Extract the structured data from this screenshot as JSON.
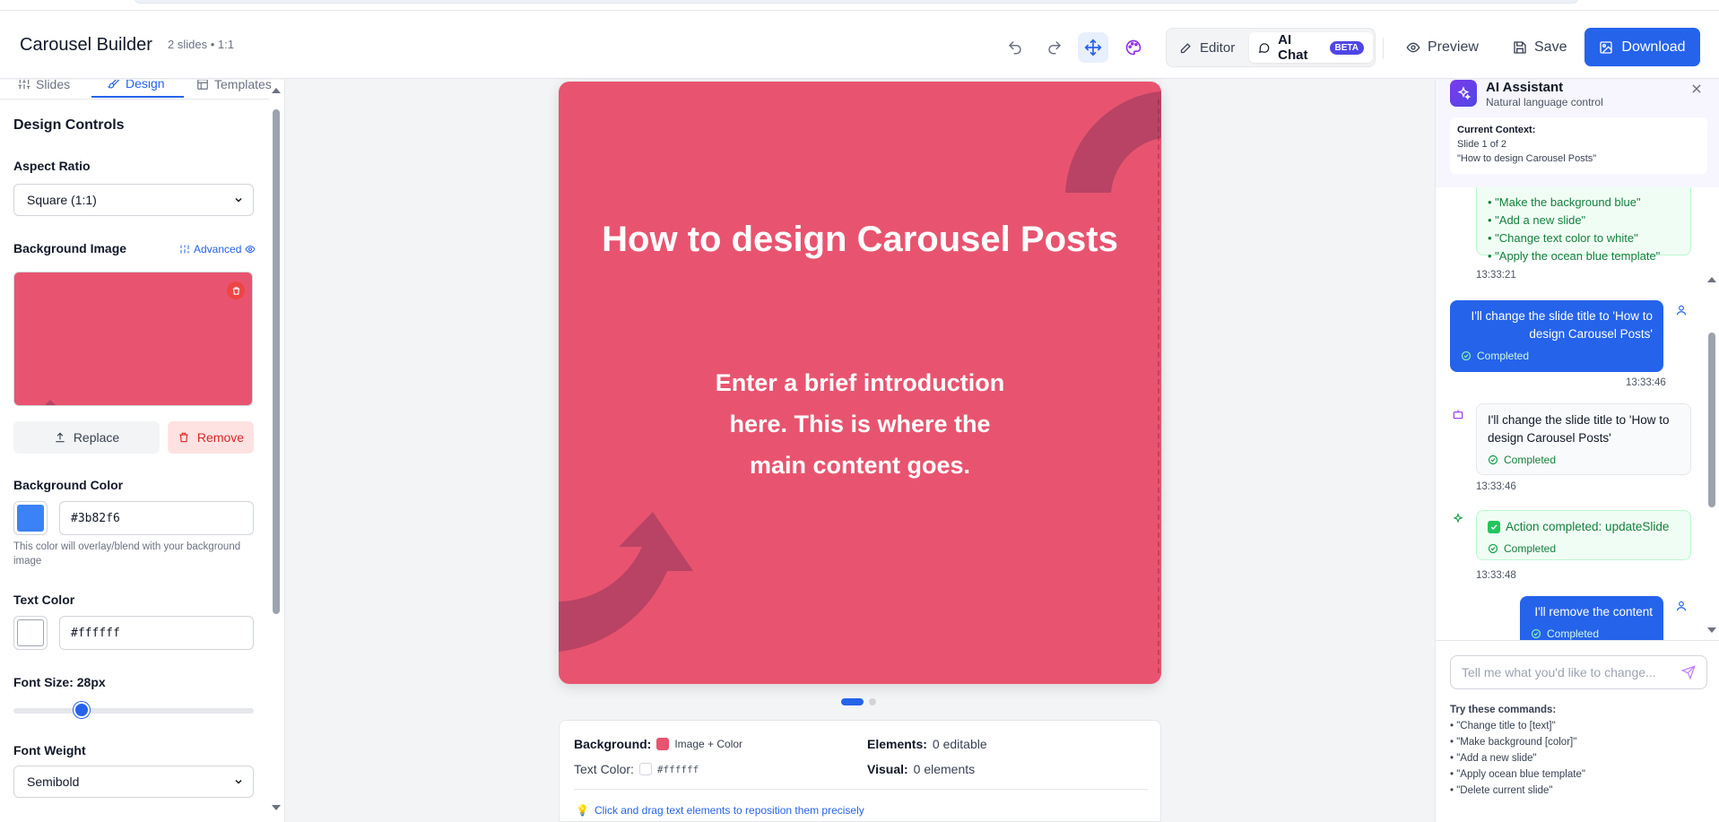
{
  "header": {
    "title": "Carousel Builder",
    "subtitle": "2 slides • 1:1",
    "modes": [
      {
        "label": "Editor"
      },
      {
        "label": "AI Chat",
        "badge": "BETA"
      }
    ],
    "preview_label": "Preview",
    "save_label": "Save",
    "download_label": "Download"
  },
  "sidebar": {
    "tabs": [
      {
        "label": "Slides"
      },
      {
        "label": "Design"
      },
      {
        "label": "Templates"
      }
    ],
    "active_tab": "Design",
    "section_title": "Design Controls",
    "aspect_ratio": {
      "label": "Aspect Ratio",
      "value": "Square (1:1)"
    },
    "background_image": {
      "label": "Background Image",
      "advanced_label": "Advanced",
      "replace_label": "Replace",
      "remove_label": "Remove"
    },
    "background_color": {
      "label": "Background Color",
      "value": "#3b82f6",
      "hint": "This color will overlay/blend with your background image"
    },
    "text_color": {
      "label": "Text Color",
      "value": "#ffffff"
    },
    "font_size": {
      "label": "Font Size: 28px",
      "value_fraction": 0.25
    },
    "font_weight": {
      "label": "Font Weight",
      "value": "Semibold"
    }
  },
  "slide": {
    "title": "How to design Carousel Posts",
    "body": "Enter a brief introduction here. This is where the main content goes.",
    "background": "#e8546f",
    "total": 2,
    "current": 1
  },
  "info": {
    "background_label": "Background:",
    "background_value": "Image + Color",
    "text_color_label": "Text Color:",
    "text_color_value": "#ffffff",
    "elements_label": "Elements:",
    "elements_value": "0 editable",
    "visual_label": "Visual:",
    "visual_value": "0 elements",
    "tip": "Click and drag text elements to reposition them precisely"
  },
  "assistant": {
    "title": "AI Assistant",
    "subtitle": "Natural language control",
    "context_label": "Current Context:",
    "context_slide": "Slide 1 of 2",
    "context_title": "\"How to design Carousel Posts\"",
    "suggestions": [
      "• \"Make the background blue\"",
      "• \"Add a new slide\"",
      "• \"Change text color to white\"",
      "• \"Apply the ocean blue template\""
    ],
    "messages": [
      {
        "time": "13:33:21"
      },
      {
        "role": "user",
        "text": "I'll change the slide title to 'How to design Carousel Posts'",
        "status": "Completed",
        "time": "13:33:46"
      },
      {
        "role": "bot",
        "text": "I'll change the slide title to 'How to design Carousel Posts'",
        "status": "Completed",
        "time": "13:33:46"
      },
      {
        "role": "bot",
        "text": "Action completed: updateSlide",
        "status": "Completed",
        "time": "13:33:48"
      },
      {
        "role": "user",
        "text": "I'll remove the content",
        "status": "Completed"
      }
    ],
    "input_placeholder": "Tell me what you'd like to change...",
    "try_title": "Try these commands:",
    "commands": [
      "• \"Change title to [text]\"",
      "• \"Make background [color]\"",
      "• \"Add a new slide\"",
      "• \"Apply ocean blue template\"",
      "• \"Delete current slide\""
    ]
  }
}
